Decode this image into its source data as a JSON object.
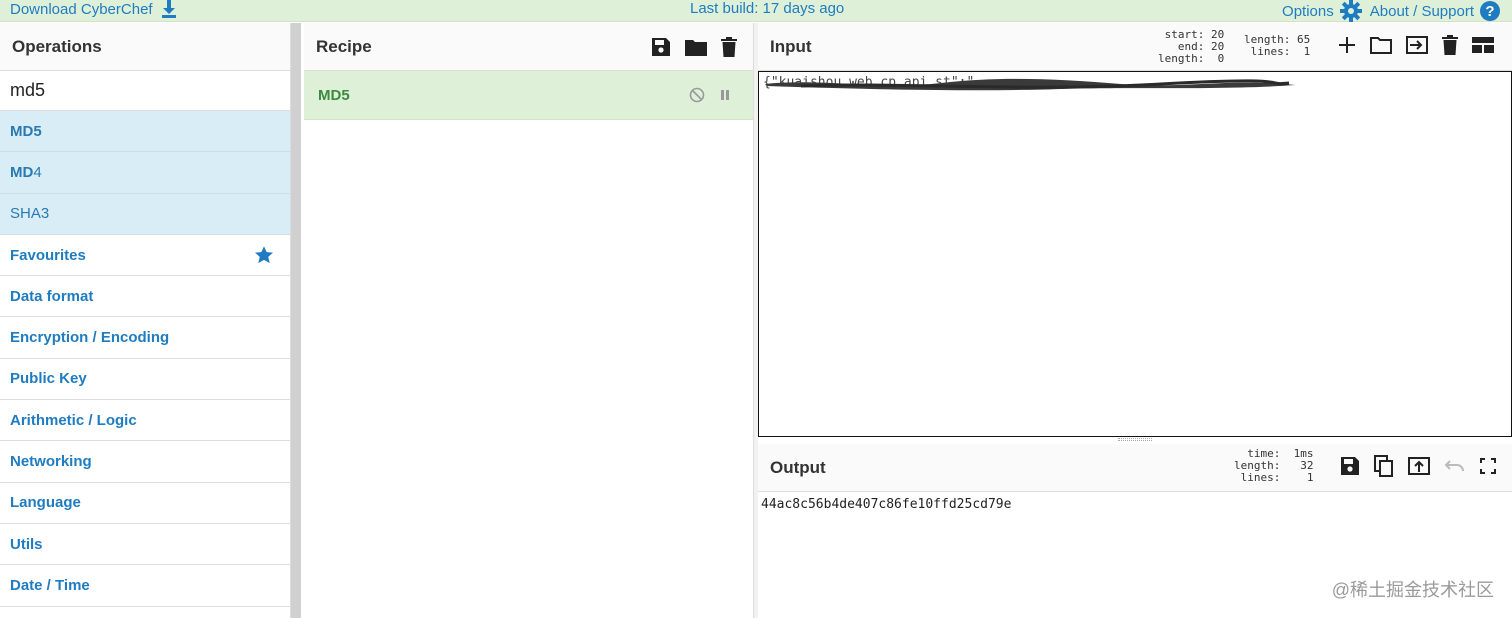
{
  "banner": {
    "download_label": "Download CyberChef",
    "build_label": "Last build: 17 days ago",
    "options_label": "Options",
    "about_label": "About / Support",
    "help_glyph": "?"
  },
  "operations": {
    "title": "Operations",
    "search_value": "md5",
    "results": [
      {
        "bold": "MD5",
        "rest": ""
      },
      {
        "bold": "MD",
        "rest": "4"
      },
      {
        "bold": "",
        "rest": "SHA3"
      }
    ],
    "categories": [
      "Favourites",
      "Data format",
      "Encryption / Encoding",
      "Public Key",
      "Arithmetic / Logic",
      "Networking",
      "Language",
      "Utils",
      "Date / Time"
    ]
  },
  "recipe": {
    "title": "Recipe",
    "ops": [
      {
        "name": "MD5"
      }
    ]
  },
  "input": {
    "title": "Input",
    "stats_a": [
      "start: 20",
      "end: 20",
      "length:  0"
    ],
    "stats_b": [
      "length: 65",
      "lines:  1"
    ],
    "text": "{\"kuaishou.web.cp.api_st\":\""
  },
  "output": {
    "title": "Output",
    "stats": [
      "time:  1ms",
      "length:   32",
      "lines:    1"
    ],
    "text": "44ac8c56b4de407c86fe10ffd25cd79e"
  },
  "watermark": "@稀土掘金技术社区",
  "colors": {
    "banner_bg": "#dff0d8",
    "link": "#1f7cc1",
    "search_hit_bg": "#d9edf7",
    "recipe_op_bg": "#dff0d8",
    "recipe_op_text": "#3c8a3c"
  }
}
